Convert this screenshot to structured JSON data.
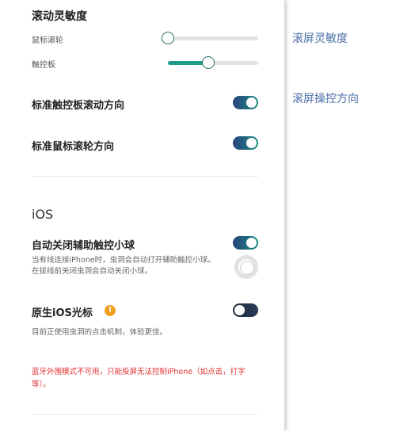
{
  "scroll": {
    "title": "滚动灵敏度",
    "mouse_label": "鼠标滚轮",
    "mouse_value": 0.0,
    "touchpad_label": "触控板",
    "touchpad_value": 0.45
  },
  "standard_touchpad": {
    "label": "标准触控板滚动方向",
    "enabled": true
  },
  "standard_mouse": {
    "label": "标准鼠标滚轮方向",
    "enabled": true
  },
  "ios": {
    "heading": "iOS",
    "assistive": {
      "label": "自动关闭辅助触控小球",
      "enabled": true,
      "desc_line1": "当有线连接iPhone时，虫洞会自动打开辅助触控小球。",
      "desc_line2": "在拔线前关闭虫洞会自动关闭小球。"
    },
    "native_cursor": {
      "label": "原生iOS光标",
      "warning_icon": "!",
      "enabled": false,
      "desc": "目前正使用虫洞的点击机制，体验更佳。"
    },
    "bluetooth_warning": "蓝牙外围模式不可用，只能投屏无法控制iPhone（如点击，打字等）。"
  },
  "callouts": {
    "sensitivity": "滚屏灵敏度",
    "direction": "滚屏操控方向"
  },
  "colors": {
    "accent": "#1f9c88",
    "toggle_start": "#29427c",
    "warning_text": "#e03030",
    "callout_text": "#4a6fa6"
  }
}
